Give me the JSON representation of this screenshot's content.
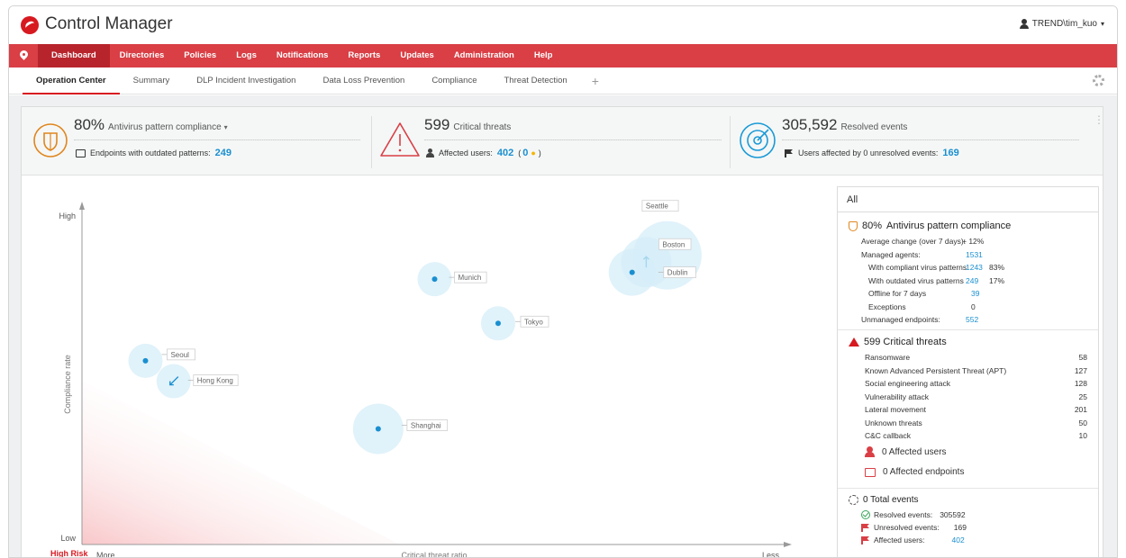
{
  "app": {
    "title": "Control Manager",
    "user": "TREND\\tim_kuo",
    "user_caret": "▾"
  },
  "nav": {
    "items": [
      {
        "label": "Dashboard"
      },
      {
        "label": "Directories"
      },
      {
        "label": "Policies"
      },
      {
        "label": "Logs"
      },
      {
        "label": "Notifications"
      },
      {
        "label": "Reports"
      },
      {
        "label": "Updates"
      },
      {
        "label": "Administration"
      },
      {
        "label": "Help"
      }
    ]
  },
  "subtabs": {
    "items": [
      {
        "label": "Operation Center"
      },
      {
        "label": "Summary"
      },
      {
        "label": "DLP Incident Investigation"
      },
      {
        "label": "Data Loss Prevention"
      },
      {
        "label": "Compliance"
      },
      {
        "label": "Threat Detection"
      }
    ],
    "add": "+"
  },
  "kpi": {
    "antivirus": {
      "value": "80%",
      "label": "Antivirus pattern compliance",
      "caret": "▾",
      "sub_label": "Endpoints with outdated patterns:",
      "sub_value": "249"
    },
    "threats": {
      "value": "599",
      "label": "Critical threats",
      "sub_label": "Affected users:",
      "sub_value": "402",
      "sub_extra_open": "(",
      "sub_extra_value": "0",
      "sub_extra_dot": "●",
      "sub_extra_close": ")"
    },
    "resolved": {
      "value": "305,592",
      "label": "Resolved events",
      "sub_label": "Users affected by 0 unresolved events:",
      "sub_value": "169"
    },
    "kebab": "⋮"
  },
  "chart": {
    "y_high": "High",
    "y_low": "Low",
    "y_label": "Compliance rate",
    "x_label": "Critical threat ratio",
    "x_more": "More",
    "x_less": "Less",
    "risk_label": "High Risk"
  },
  "chart_data": {
    "type": "scatter",
    "title": "",
    "xlabel": "Critical threat ratio",
    "ylabel": "Compliance rate",
    "points": [
      {
        "label": "Seattle",
        "x": 0.83,
        "y": 0.85,
        "size": 38,
        "marker": "none"
      },
      {
        "label": "Boston",
        "x": 0.8,
        "y": 0.83,
        "size": 28,
        "marker": "up-arrow"
      },
      {
        "label": "Dublin",
        "x": 0.78,
        "y": 0.8,
        "size": 26,
        "marker": "dot"
      },
      {
        "label": "Munich",
        "x": 0.5,
        "y": 0.78,
        "size": 19,
        "marker": "dot"
      },
      {
        "label": "Tokyo",
        "x": 0.59,
        "y": 0.65,
        "size": 19,
        "marker": "dot"
      },
      {
        "label": "Seoul",
        "x": 0.09,
        "y": 0.54,
        "size": 19,
        "marker": "dot"
      },
      {
        "label": "Hong Kong",
        "x": 0.13,
        "y": 0.48,
        "size": 19,
        "marker": "down-arrow"
      },
      {
        "label": "Shanghai",
        "x": 0.42,
        "y": 0.34,
        "size": 28,
        "marker": "dot"
      }
    ]
  },
  "rpanel": {
    "head": "All",
    "av": {
      "title_value": "80%",
      "title_label": "Antivirus pattern compliance",
      "rows": [
        {
          "label": "Average change (over 7 days):",
          "value": "+ 12%",
          "pct": ""
        },
        {
          "label": "Managed agents:",
          "value": "1531",
          "pct": ""
        },
        {
          "label": "With compliant virus patterns",
          "value": "1243",
          "pct": "83%"
        },
        {
          "label": "With outdated virus patterns",
          "value": "249",
          "pct": "17%"
        },
        {
          "label": "Offline for 7 days",
          "value": "39",
          "pct": ""
        },
        {
          "label": "Exceptions",
          "value": "0",
          "pct": ""
        },
        {
          "label": "Unmanaged endpoints:",
          "value": "552",
          "pct": ""
        }
      ]
    },
    "threats": {
      "title": "599 Critical threats",
      "rows": [
        {
          "label": "Ransomware",
          "value": "58"
        },
        {
          "label": "Known Advanced Persistent Threat (APT)",
          "value": "127"
        },
        {
          "label": "Social engineering attack",
          "value": "128"
        },
        {
          "label": "Vulnerability attack",
          "value": "25"
        },
        {
          "label": "Lateral movement",
          "value": "201"
        },
        {
          "label": "Unknown threats",
          "value": "50"
        },
        {
          "label": "C&C callback",
          "value": "10"
        }
      ],
      "affected_users": "0 Affected users",
      "affected_endpoints": "0 Affected endpoints"
    },
    "events": {
      "title": "0 Total events",
      "resolved_label": "Resolved events:",
      "resolved_value": "305592",
      "unresolved_label": "Unresolved events:",
      "unresolved_value": "169",
      "affected_label": "Affected users:",
      "affected_value": "402"
    }
  }
}
